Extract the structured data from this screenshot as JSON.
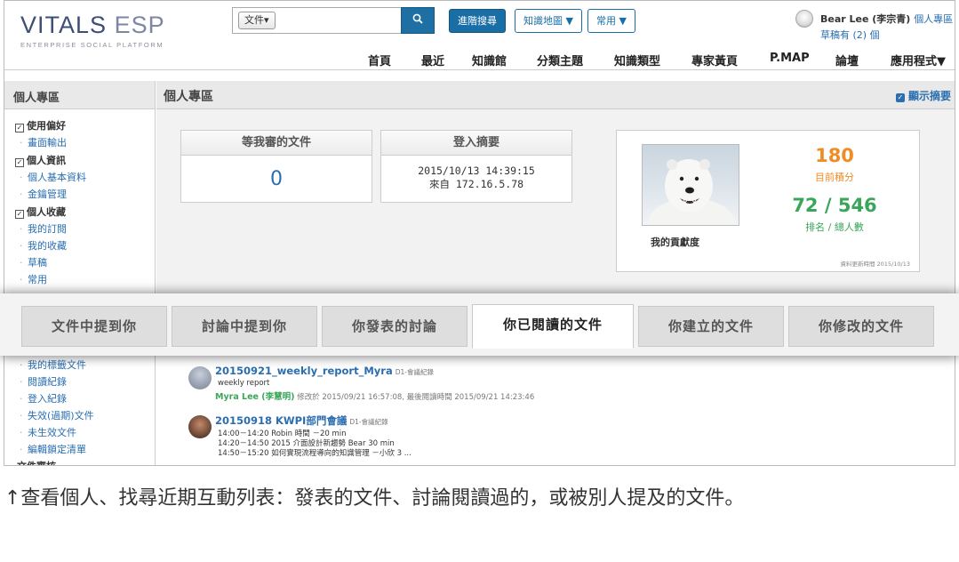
{
  "header": {
    "logo_main": "VITALS",
    "logo_esp": "ESP",
    "logo_sub": "ENTERPRISE SOCIAL PLATFORM",
    "search_type": "文件▾",
    "search_placeholder": "",
    "search_icon": "search-icon",
    "advanced_search": "進階搜尋",
    "knowledge_map": "知識地圖 ▼",
    "common": "常用 ▼",
    "user_name": "Bear Lee (李宗青)",
    "user_zone_link": "個人專區",
    "drafts": "草稿有 (2) 個"
  },
  "nav": [
    "首頁",
    "最近",
    "知識館",
    "分類主題",
    "知識類型",
    "專家黃頁",
    "P.MAP",
    "論壇",
    "應用程式▼"
  ],
  "sidebar": {
    "title": "個人專區",
    "groups": [
      {
        "label": "使用偏好",
        "items": [
          "畫面輸出"
        ]
      },
      {
        "label": "個人資訊",
        "items": [
          "個人基本資料",
          "金鑰管理"
        ]
      },
      {
        "label": "個人收藏",
        "items": [
          "我的訂閱",
          "我的收藏",
          "草稿",
          "常用"
        ]
      }
    ],
    "lower_items": [
      "我的標籤文件",
      "閱讀紀錄",
      "登入紀錄",
      "失效(過期)文件",
      "未生效文件",
      "編輯鎖定清單"
    ],
    "cut_label": "文件審核"
  },
  "main": {
    "title": "個人專區",
    "show_summary": "顯示摘要",
    "review_card": {
      "title": "等我審的文件",
      "count": "0"
    },
    "login_card": {
      "title": "登入摘要",
      "time": "2015/10/13 14:39:15",
      "from": "來自 172.16.5.78"
    },
    "contrib": {
      "label": "我的貢獻度",
      "points": "180",
      "points_label": "目前積分",
      "rank": "72 / 546",
      "rank_label": "排名 / 總人數",
      "update_note": "資料更新時間 2015/10/13"
    }
  },
  "tabs": [
    "文件中提到你",
    "討論中提到你",
    "你發表的討論",
    "你已閱讀的文件",
    "你建立的文件",
    "你修改的文件"
  ],
  "active_tab": 3,
  "feed": [
    {
      "title": "20150921_weekly_report_Myra",
      "category": "D1-會議紀錄",
      "summary": "weekly report",
      "author": "Myra Lee (李慧明)",
      "meta": "修改於 2015/09/21 16:57:08, 最後閱讀時間 2015/09/21 14:23:46"
    },
    {
      "title": "20150918 KWPI部門會議",
      "category": "D1-會議紀錄",
      "lines": [
        "14:00－14:20 Robin 時間 －20 min",
        "14:20－14:50 2015 介面設計新趨勢 Bear 30 min",
        "14:50－15:20 如何實現流程導向的知識管理 －小欣 3 ..."
      ]
    }
  ],
  "caption": "↑查看個人、找尋近期互動列表：發表的文件、討論閱讀過的，或被別人提及的文件。"
}
